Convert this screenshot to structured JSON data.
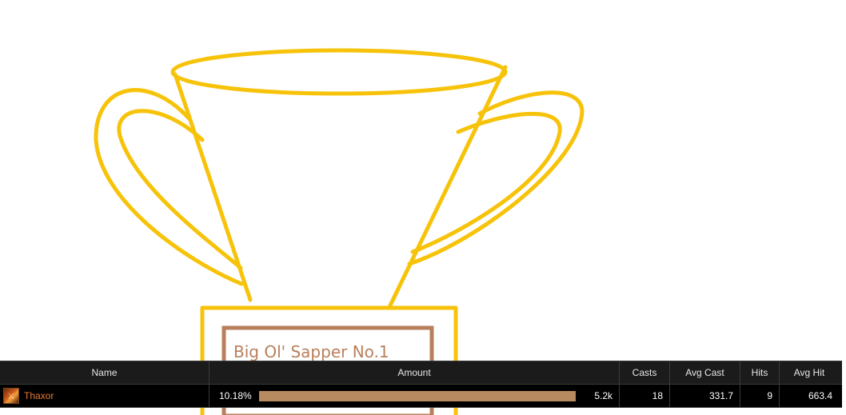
{
  "plaque": {
    "text": "Big Ol' Sapper No.1"
  },
  "colors": {
    "trophy": "#f7c30a",
    "plaque_border": "#b97f5c",
    "bar": "#b88a5f",
    "player_name": "#e87a35"
  },
  "table": {
    "headers": {
      "name": "Name",
      "amount": "Amount",
      "casts": "Casts",
      "avg_cast": "Avg Cast",
      "hits": "Hits",
      "avg_hit": "Avg Hit"
    },
    "rows": [
      {
        "icon": "warrior-class-icon",
        "name": "Thaxor",
        "percent": "10.18%",
        "bar_fraction": 0.1018,
        "amount": "5.2k",
        "casts": "18",
        "avg_cast": "331.7",
        "hits": "9",
        "avg_hit": "663.4"
      }
    ]
  }
}
